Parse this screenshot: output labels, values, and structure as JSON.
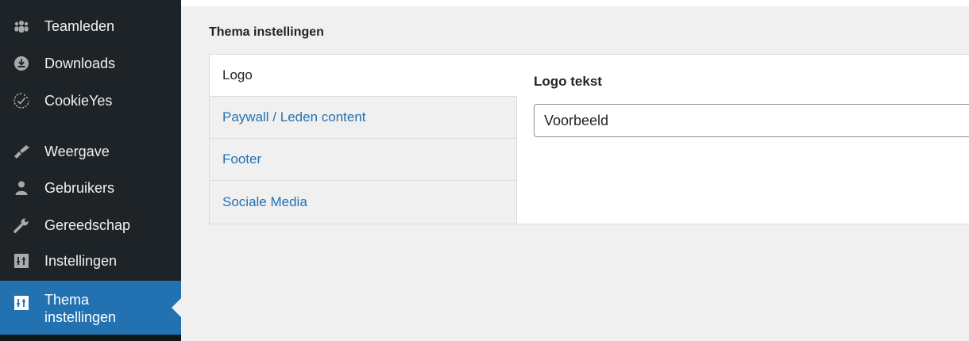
{
  "sidebar": {
    "items": [
      {
        "label": "Teamleden",
        "icon": "groups-icon"
      },
      {
        "label": "Downloads",
        "icon": "download-icon"
      },
      {
        "label": "CookieYes",
        "icon": "cookieyes-icon"
      },
      {
        "label": "Weergave",
        "icon": "appearance-brush-icon"
      },
      {
        "label": "Gebruikers",
        "icon": "users-icon"
      },
      {
        "label": "Gereedschap",
        "icon": "tools-wrench-icon"
      },
      {
        "label": "Instellingen",
        "icon": "settings-sliders-icon"
      },
      {
        "label_line1": "Thema",
        "label_line2": "instellingen",
        "icon": "settings-sliders-icon",
        "active": true
      }
    ]
  },
  "page": {
    "title": "Thema instellingen"
  },
  "tabs": [
    {
      "label": "Logo",
      "active": true
    },
    {
      "label": "Paywall / Leden content"
    },
    {
      "label": "Footer"
    },
    {
      "label": "Sociale Media"
    }
  ],
  "form": {
    "logo_label": "Logo tekst",
    "logo_value": "Voorbeeld"
  },
  "colors": {
    "sidebar_bg": "#1d2327",
    "active_bg": "#2271b1",
    "link": "#2271b1",
    "page_bg": "#f0f0f1"
  }
}
